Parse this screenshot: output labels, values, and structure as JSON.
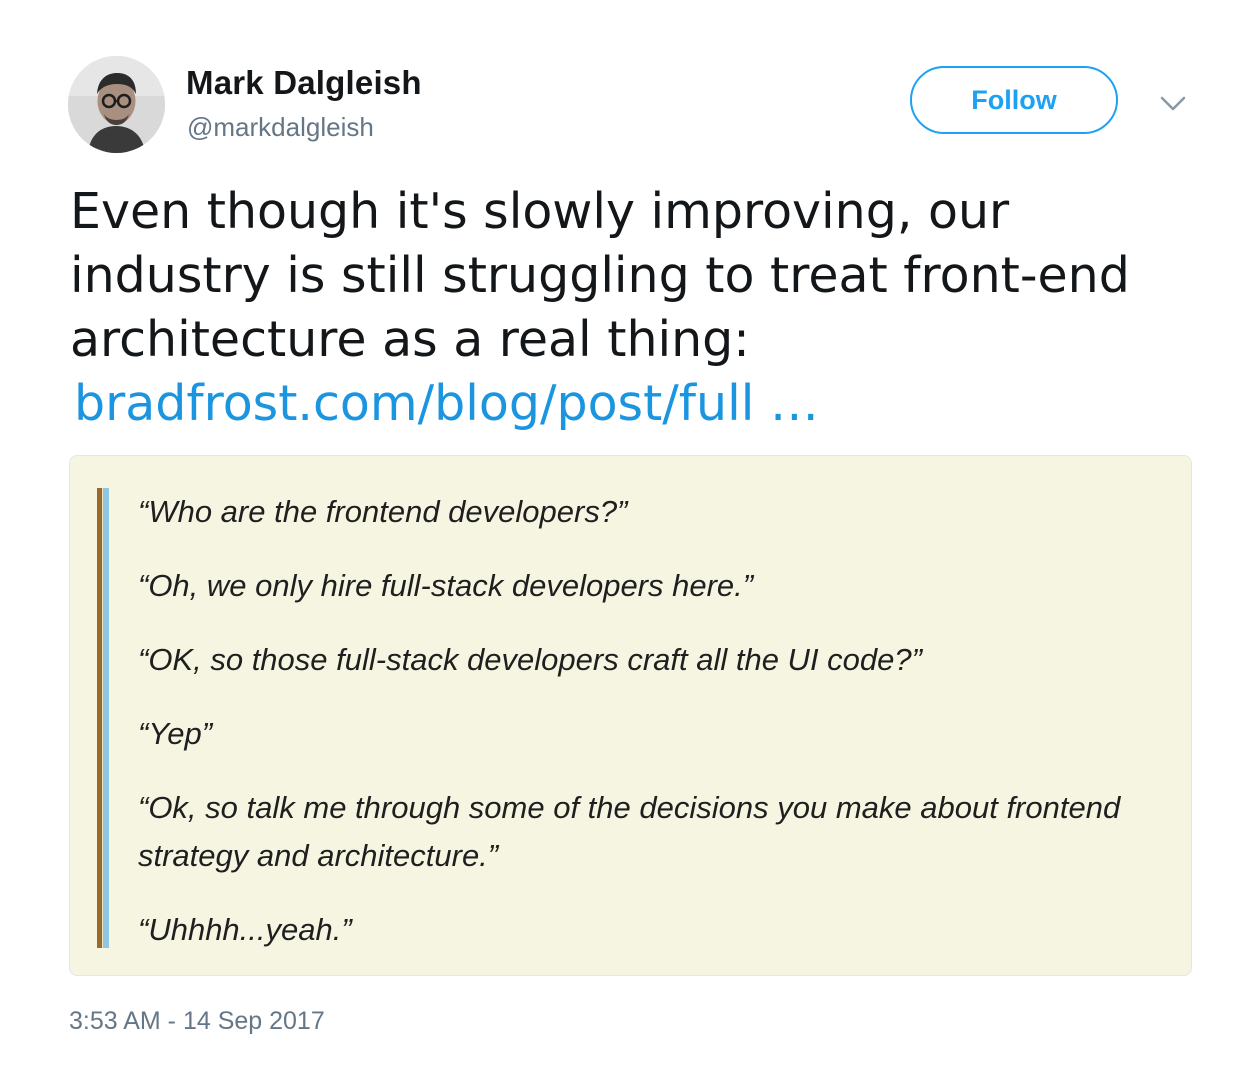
{
  "author": {
    "display_name": "Mark Dalgleish",
    "handle": "@markdalgleish",
    "avatar_icon": "user-avatar-photo"
  },
  "actions": {
    "follow_label": "Follow",
    "more_icon": "chevron-down-icon"
  },
  "tweet": {
    "text": "Even though it's slowly improving, our industry is still struggling to treat front-end architecture as a real thing:",
    "link_text": "bradfrost.com/blog/post/full …"
  },
  "media": {
    "quote_lines": [
      "“Who are the frontend developers?”",
      "“Oh, we only hire full-stack developers here.”",
      "“OK, so those full-stack developers craft all the UI code?”",
      "“Yep”",
      "“Ok, so talk me through some of the decisions you make about frontend strategy and architecture.”",
      "“Uhhhh...yeah.”"
    ]
  },
  "timestamp": "3:53 AM - 14 Sep 2017",
  "colors": {
    "accent": "#1da1f2",
    "link": "#1b95e0",
    "secondary_text": "#657786",
    "card_background": "#f6f5e2"
  }
}
